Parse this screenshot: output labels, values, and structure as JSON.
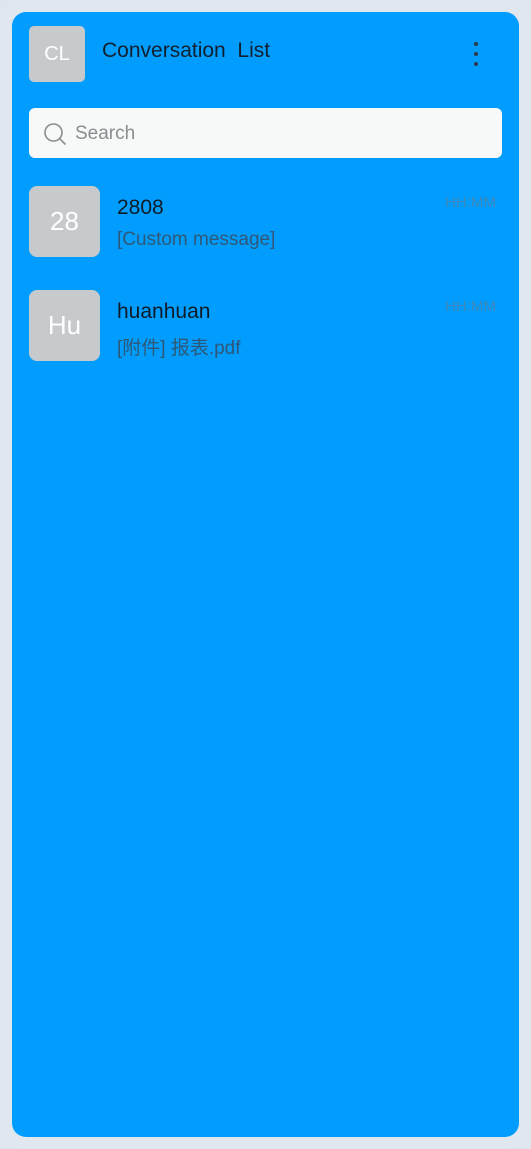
{
  "header": {
    "avatar_text": "CL",
    "title": "Conversation  List",
    "more_icon": "more-vertical-icon"
  },
  "search": {
    "placeholder": "Search",
    "icon": "search-icon"
  },
  "conversations": [
    {
      "avatar_text": "28",
      "name": "2808",
      "preview": "[Custom message]",
      "time": "HH:MM"
    },
    {
      "avatar_text": "Hu",
      "name": "huanhuan",
      "preview": "[附件] 报表.pdf",
      "time": "HH:MM"
    }
  ],
  "colors": {
    "screen_background": "#009dfe",
    "device_frame": "#e0e7ef",
    "avatar_background": "#c7cacd",
    "search_background": "#f7f9f8"
  }
}
